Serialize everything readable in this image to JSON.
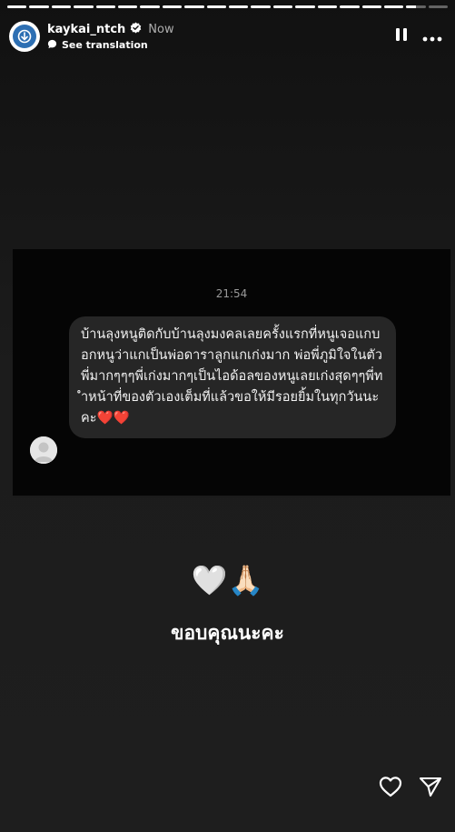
{
  "progress": [
    1,
    1,
    1,
    1,
    1,
    1,
    1,
    1,
    1,
    1,
    1,
    1,
    1,
    1,
    1,
    1,
    1,
    1,
    0.5,
    0
  ],
  "header": {
    "username": "kaykai_ntch",
    "time": "Now",
    "see_translation": "See translation",
    "verified_icon": "verified-badge-icon",
    "pause_icon": "pause-icon",
    "more_icon": "more-icon"
  },
  "chat": {
    "time": "21:54",
    "message": "บ้านลุงหนูติดกับบ้านลุงมงคลเลยครั้งแรกที่หนูเจอแกบอกหนูว่าแกเป็นพ่อดาราลูกแกเก่งมาก พ่อพี่ภูมิใจในตัวพี่มากๆๆๆพี่เก่งมากๆเป็นไอด้อลของหนูเลยเก่งสุดๆๆพี่ทำหน้าที่ของตัวเองเต็มที่แล้วขอให้มีรอยยิ้มในทุกวันนะคะ❤️❤️"
  },
  "caption": {
    "emojis": "🤍🙏🏻",
    "text": "ขอบคุณนะคะ"
  },
  "footer": {
    "like_icon": "heart-icon",
    "share_icon": "send-icon"
  },
  "colors": {
    "bubble": "#262626",
    "verified": "#ffffff"
  }
}
